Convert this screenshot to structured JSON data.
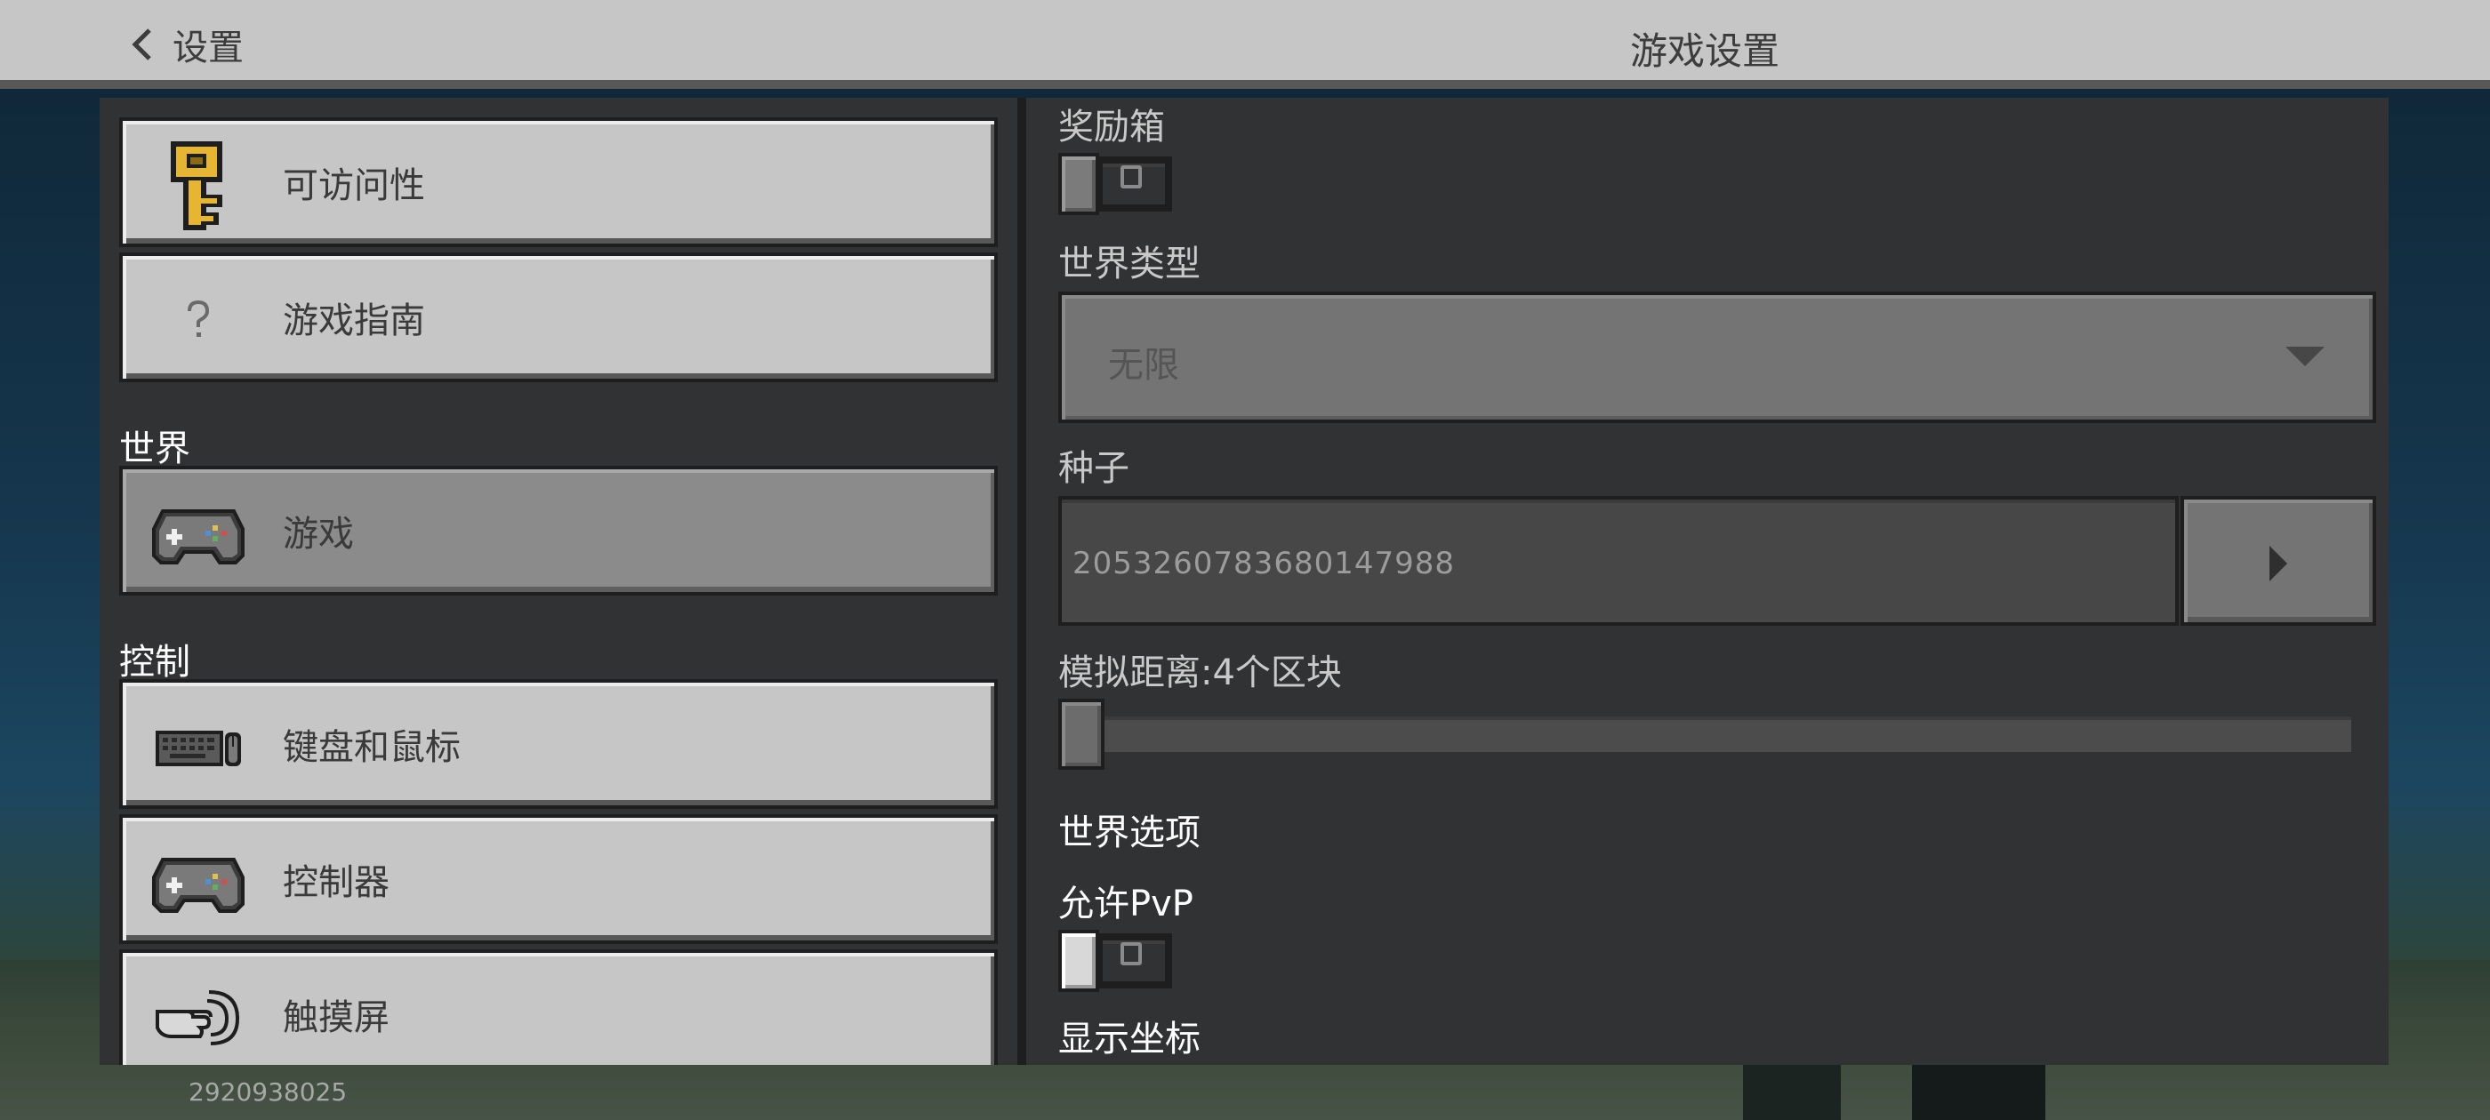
{
  "header": {
    "back_label": "设置",
    "title": "游戏设置"
  },
  "sidebar": {
    "items_top": [
      {
        "label": "可访问性",
        "icon": "key-icon"
      },
      {
        "label": "游戏指南",
        "icon": "question-icon"
      }
    ],
    "section_world": "世界",
    "world_items": [
      {
        "label": "游戏",
        "icon": "gamepad-icon",
        "selected": true
      }
    ],
    "section_controls": "控制",
    "control_items": [
      {
        "label": "键盘和鼠标",
        "icon": "keyboard-mouse-icon"
      },
      {
        "label": "控制器",
        "icon": "gamepad-icon"
      },
      {
        "label": "触摸屏",
        "icon": "touch-hand-icon"
      }
    ]
  },
  "settings": {
    "bonus_chest_label": "奖励箱",
    "bonus_chest_on": false,
    "world_type_label": "世界类型",
    "world_type_value": "无限",
    "seed_label": "种子",
    "seed_value": "2053260783680147988",
    "sim_distance_label": "模拟距离:4个区块",
    "sim_distance_fraction": 0.0,
    "world_options_heading": "世界选项",
    "allow_pvp_label": "允许PvP",
    "allow_pvp_on": false,
    "show_coords_label": "显示坐标"
  },
  "footer": {
    "id_text": "2920938025"
  },
  "colors": {
    "panel": "#313233",
    "button": "#c6c6c6",
    "selected": "#8b8b8b",
    "border": "#1e1e1f"
  }
}
